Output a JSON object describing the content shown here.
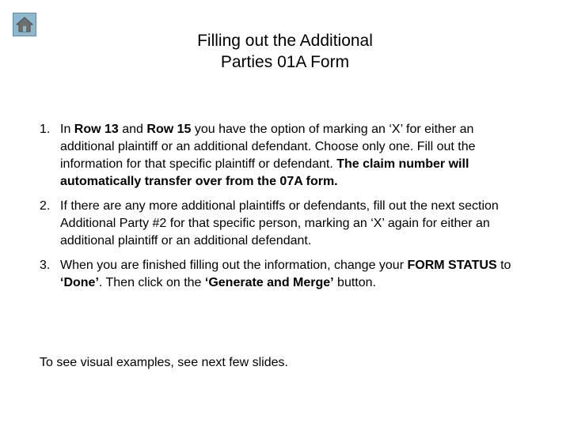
{
  "home_button": {
    "icon": "home-icon"
  },
  "title": {
    "line1": "Filling out the Additional",
    "line2": "Parties 01A Form"
  },
  "steps": [
    {
      "number": "1.",
      "parts": [
        {
          "text": "In ",
          "bold": false
        },
        {
          "text": "Row 13",
          "bold": true
        },
        {
          "text": " and ",
          "bold": false
        },
        {
          "text": "Row 15",
          "bold": true
        },
        {
          "text": " you have the option of marking an ‘X’ for either an additional plaintiff or an additional defendant. Choose only one. Fill out the information for that specific plaintiff or defendant. ",
          "bold": false
        },
        {
          "text": "The claim number will automatically transfer over from the 07A form.",
          "bold": true
        }
      ]
    },
    {
      "number": "2.",
      "parts": [
        {
          "text": "If there are any more additional plaintiffs or defendants, fill out the next section Additional Party #2 for that specific person, marking an ‘X’ again for either an additional plaintiff or an additional defendant.",
          "bold": false
        }
      ]
    },
    {
      "number": "3.",
      "parts": [
        {
          "text": "When you are finished filling out the information, change your ",
          "bold": false
        },
        {
          "text": "FORM STATUS",
          "bold": true
        },
        {
          "text": " to ",
          "bold": false
        },
        {
          "text": "‘Done’",
          "bold": true
        },
        {
          "text": ". Then click on the ",
          "bold": false
        },
        {
          "text": "‘Generate and Merge’",
          "bold": true
        },
        {
          "text": " button.",
          "bold": false
        }
      ]
    }
  ],
  "footer": "To see visual examples, see next few slides."
}
